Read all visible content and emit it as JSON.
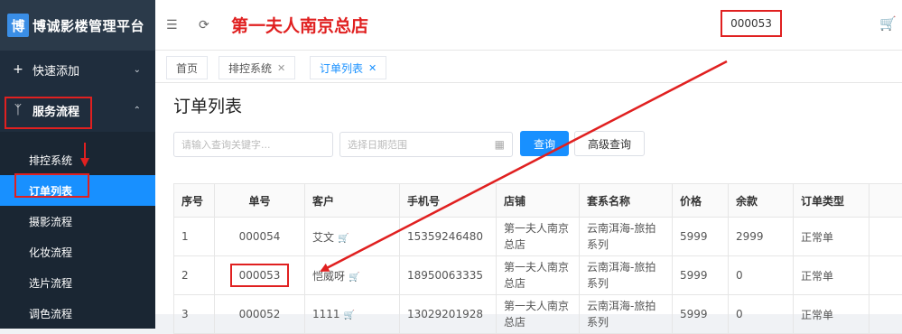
{
  "brand": {
    "mark": "博",
    "name": "博诚影楼管理平台"
  },
  "sidebar": {
    "quick_add": "快速添加",
    "service_flow": "服务流程",
    "subitems": [
      "排控系统",
      "订单列表",
      "摄影流程",
      "化妆流程",
      "选片流程",
      "调色流程"
    ]
  },
  "header": {
    "store_name": "第一夫人南京总店",
    "order_no": "000053"
  },
  "tabs": [
    {
      "label": "首页"
    },
    {
      "label": "排控系统"
    },
    {
      "label": "订单列表"
    }
  ],
  "page": {
    "title": "订单列表",
    "keyword_placeholder": "请输入查询关键字...",
    "date_placeholder": "选择日期范围",
    "search_btn": "查询",
    "advanced_btn": "高级查询"
  },
  "table": {
    "headers": [
      "序号",
      "单号",
      "客户",
      "手机号",
      "店铺",
      "套系名称",
      "价格",
      "余款",
      "订单类型"
    ],
    "rows": [
      {
        "idx": "1",
        "order": "000054",
        "customer": "艾文",
        "phone": "15359246480",
        "store": "第一夫人南京总店",
        "package": "云南洱海-旅拍系列",
        "price": "5999",
        "balance": "2999",
        "type": "正常单"
      },
      {
        "idx": "2",
        "order": "000053",
        "customer": "恺威呀",
        "phone": "18950063335",
        "store": "第一夫人南京总店",
        "package": "云南洱海-旅拍系列",
        "price": "5999",
        "balance": "0",
        "type": "正常单"
      },
      {
        "idx": "3",
        "order": "000052",
        "customer": "1111",
        "phone": "13029201928",
        "store": "第一夫人南京总店",
        "package": "云南洱海-旅拍系列",
        "price": "5999",
        "balance": "0",
        "type": "正常单"
      }
    ]
  },
  "colors": {
    "sidebar_bg": "#1f2d3d",
    "accent": "#1890ff",
    "annotation": "#e02020"
  }
}
